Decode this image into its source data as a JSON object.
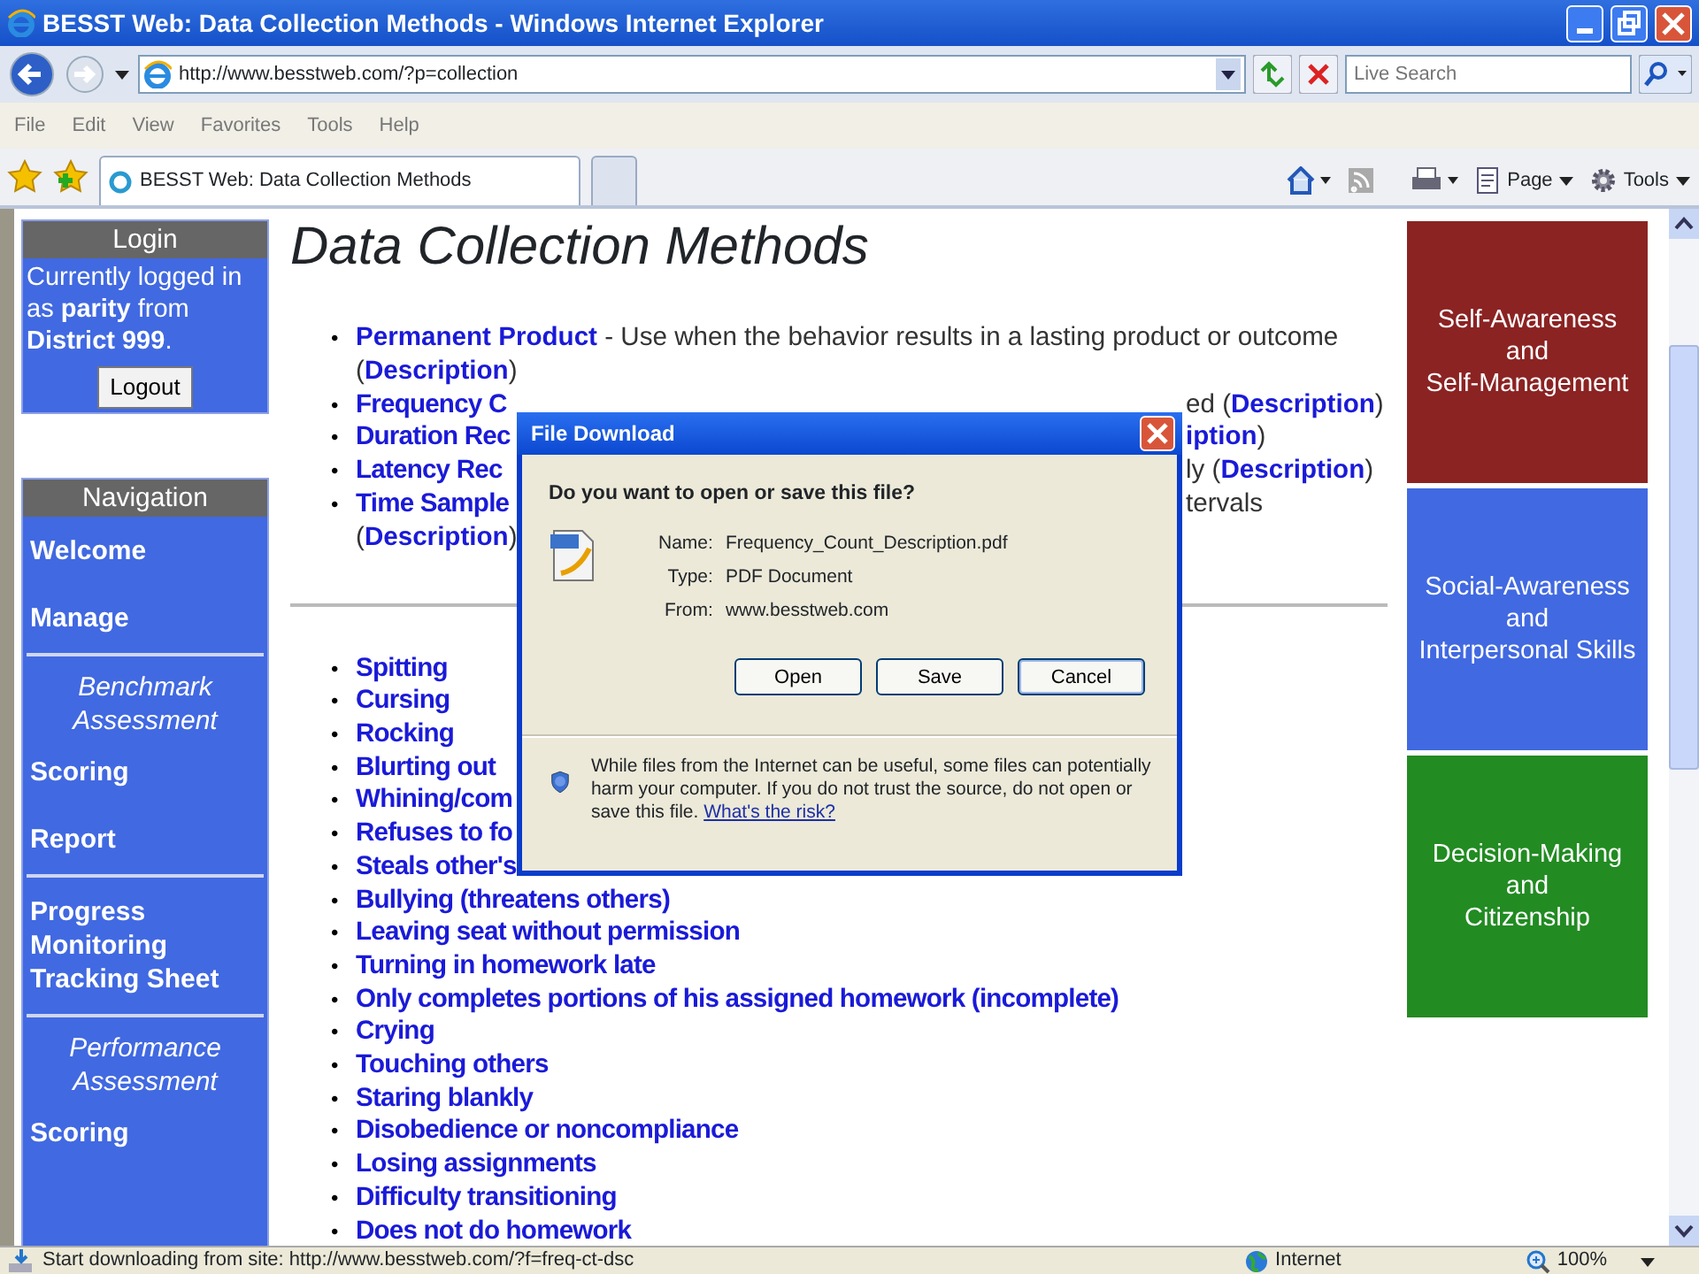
{
  "window": {
    "title": "BESST Web: Data Collection Methods - Windows Internet Explorer"
  },
  "address_bar": {
    "url": "http://www.besstweb.com/?p=collection"
  },
  "search": {
    "placeholder": "Live Search"
  },
  "menu": [
    "File",
    "Edit",
    "View",
    "Favorites",
    "Tools",
    "Help"
  ],
  "tabs": [
    {
      "label": "BESST Web: Data Collection Methods",
      "selected": true
    }
  ],
  "command_bar": [
    "Page",
    "Tools"
  ],
  "login": {
    "header": "Login",
    "text": "Currently logged in as **parity** from **District 999**.",
    "button": "Logout"
  },
  "navigation": {
    "header": "Navigation",
    "items": [
      {
        "kind": "link",
        "label": "Welcome"
      },
      {
        "kind": "link",
        "label": "Manage"
      },
      {
        "kind": "divider"
      },
      {
        "kind": "heading",
        "label": "Benchmark Assessment"
      },
      {
        "kind": "link",
        "label": "Scoring"
      },
      {
        "kind": "link",
        "label": "Report"
      },
      {
        "kind": "divider"
      },
      {
        "kind": "link",
        "label": "Progress Monitoring Tracking Sheet"
      },
      {
        "kind": "divider"
      },
      {
        "kind": "heading",
        "label": "Performance Assessment"
      },
      {
        "kind": "link",
        "label": "Scoring"
      }
    ]
  },
  "heading": "Data Collection Methods",
  "methods": [
    {
      "kind": "full",
      "bullet": "•",
      "left": [
        {
          "kind": "link",
          "text": "Permanent Product"
        },
        {
          "kind": "text",
          "text": " - Use when the behavior results in a lasting product or outcome"
        }
      ]
    },
    {
      "kind": "continuation",
      "left": [
        {
          "kind": "text",
          "text": "("
        },
        {
          "kind": "link",
          "text": "Description"
        },
        {
          "kind": "text",
          "text": ")"
        }
      ]
    },
    {
      "kind": "covered",
      "bullet": "•",
      "left": [
        {
          "kind": "link",
          "text": "Frequency C"
        }
      ],
      "right": [
        {
          "kind": "text",
          "text": "ed ("
        },
        {
          "kind": "link",
          "text": "Description"
        },
        {
          "kind": "text",
          "text": ")"
        }
      ]
    },
    {
      "kind": "covered",
      "bullet": "•",
      "left": [
        {
          "kind": "link",
          "text": "Duration Rec"
        }
      ],
      "right": [
        {
          "kind": "link",
          "text": "iption"
        },
        {
          "kind": "text",
          "text": ")"
        }
      ]
    },
    {
      "kind": "covered",
      "bullet": "•",
      "left": [
        {
          "kind": "link",
          "text": "Latency Rec"
        }
      ],
      "right": [
        {
          "kind": "text",
          "text": "ly ("
        },
        {
          "kind": "link",
          "text": "Description"
        },
        {
          "kind": "text",
          "text": ")"
        }
      ]
    },
    {
      "kind": "covered",
      "bullet": "•",
      "left": [
        {
          "kind": "link",
          "text": "Time Sample"
        }
      ],
      "right": [
        {
          "kind": "text",
          "text": "tervals"
        }
      ]
    },
    {
      "kind": "continuation",
      "left": [
        {
          "kind": "text",
          "text": "("
        },
        {
          "kind": "link",
          "text": "Description"
        },
        {
          "kind": "text",
          "text": ")"
        }
      ]
    }
  ],
  "behaviors": [
    {
      "bullet": "•",
      "label": "Spitting"
    },
    {
      "bullet": "•",
      "label": "Cursing"
    },
    {
      "bullet": "•",
      "label": "Rocking"
    },
    {
      "bullet": "•",
      "label": "Blurting out"
    },
    {
      "bullet": "•",
      "label": "Whining/com"
    },
    {
      "bullet": "•",
      "label": "Refuses to fo"
    },
    {
      "bullet": "•",
      "label": "Steals other's"
    },
    {
      "bullet": "•",
      "label": "Bullying (threatens others)"
    },
    {
      "bullet": "•",
      "label": "Leaving seat without permission"
    },
    {
      "bullet": "•",
      "label": "Turning in homework late"
    },
    {
      "bullet": "•",
      "label": "Only completes portions of his assigned homework (incomplete)"
    },
    {
      "bullet": "•",
      "label": "Crying"
    },
    {
      "bullet": "•",
      "label": "Touching others"
    },
    {
      "bullet": "•",
      "label": "Staring blankly"
    },
    {
      "bullet": "•",
      "label": "Disobedience or noncompliance"
    },
    {
      "bullet": "•",
      "label": "Losing assignments"
    },
    {
      "bullet": "•",
      "label": "Difficulty transitioning"
    },
    {
      "bullet": "•",
      "label": "Does not do homework"
    }
  ],
  "tiles": [
    {
      "lines": [
        "Self-Awareness",
        "and",
        "Self-Management"
      ],
      "color": "#8b2323"
    },
    {
      "lines": [
        "Social-Awareness",
        "and",
        "Interpersonal Skills"
      ],
      "color": "#4169e1"
    },
    {
      "lines": [
        "Decision-Making",
        "and",
        "Citizenship"
      ],
      "color": "#228b22"
    }
  ],
  "dialog": {
    "title": "File Download",
    "question": "Do you want to open or save this file?",
    "fields": [
      {
        "label": "Name:",
        "value": "Frequency_Count_Description.pdf"
      },
      {
        "label": "Type:",
        "value": "PDF Document"
      },
      {
        "label": "From:",
        "value": "www.besstweb.com"
      }
    ],
    "buttons": [
      "Open",
      "Save",
      "Cancel"
    ],
    "warning": "While files from the Internet can be useful, some files can potentially harm your computer. If you do not trust the source, do not open or save this file.",
    "warning_link": "What's the risk?"
  },
  "status_bar": {
    "text": "Start downloading from site: http://www.besstweb.com/?f=freq-ct-dsc",
    "zone": "Internet",
    "zoom": "100%"
  }
}
